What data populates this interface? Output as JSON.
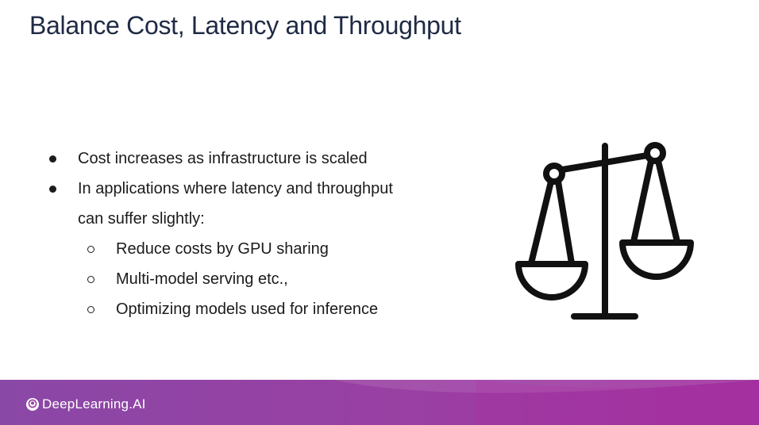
{
  "slide": {
    "title": "Balance Cost, Latency and Throughput"
  },
  "bullets": {
    "item1": "Cost increases as infrastructure is scaled",
    "item2_line1": "In applications where latency and throughput",
    "item2_line2": "can suffer slightly:",
    "sub1": "Reduce costs by GPU sharing",
    "sub2": "Multi-model serving etc.,",
    "sub3": "Optimizing models used for inference"
  },
  "footer": {
    "brand": "DeepLearning.AI"
  },
  "icons": {
    "illustration": "balance-scale-icon",
    "logo": "deeplearning-logo-icon"
  },
  "colors": {
    "title": "#1f2a44",
    "text": "#1b1b1b",
    "footer_start": "#8a48a6",
    "footer_end": "#a2309f"
  }
}
